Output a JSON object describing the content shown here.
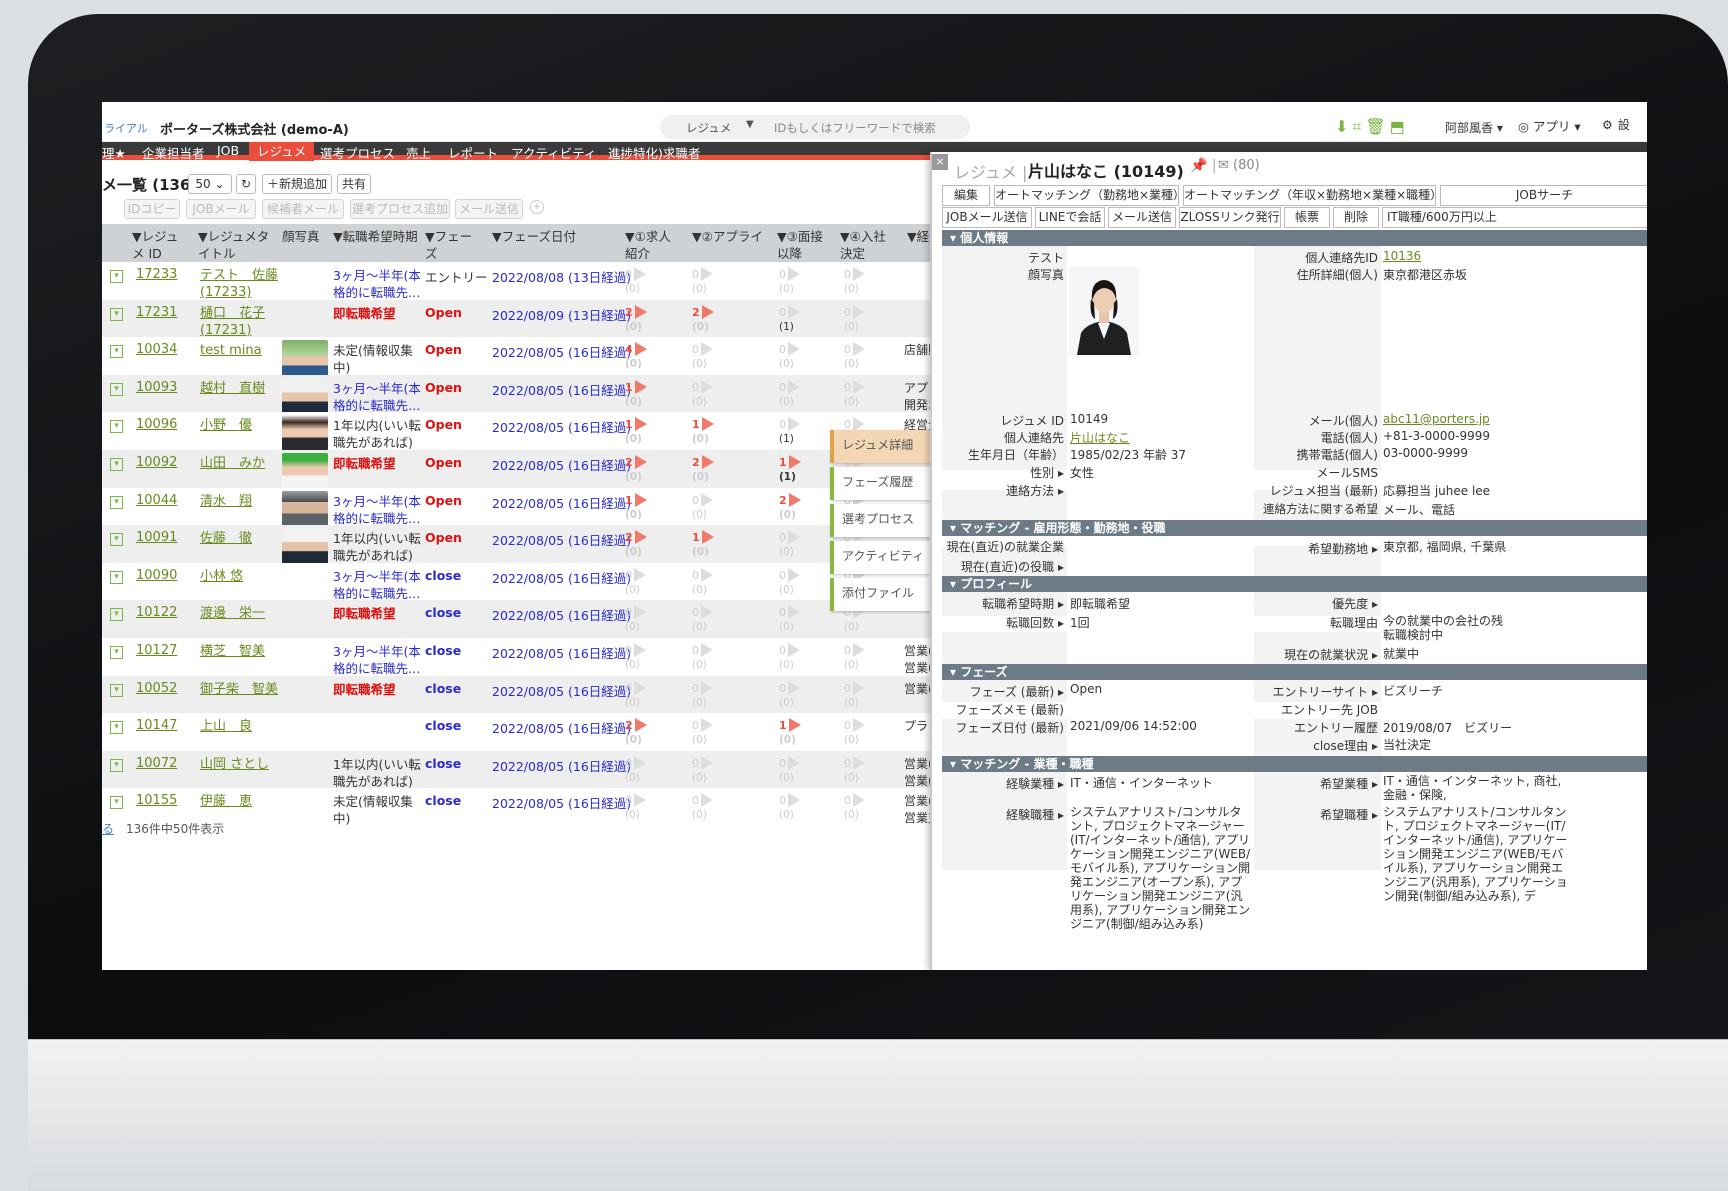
{
  "header": {
    "brand_sub": "ライアル",
    "company": "ポーターズ株式会社 (demo-A)",
    "search_select": "レジュメ",
    "search_arrow": "▼",
    "search_placeholder": "IDもしくはフリーワードで検索",
    "user": "阿部風香 ▾",
    "app": "◎ アプリ ▾",
    "settings": "設"
  },
  "nav": [
    "理★",
    "企業担当者",
    "JOB",
    "レジュメ",
    "選考プロセス",
    "売上",
    "レポート",
    "アクティビティ",
    "進捗特化)求職者"
  ],
  "list": {
    "title": "メ一覧 (136)",
    "page_size": "50 ⌄",
    "refresh": "↻",
    "add": "＋新規追加",
    "share": "共有",
    "actions": [
      "IDコピー",
      "JOBメール",
      "候補者メール",
      "選考プロセス追加",
      "メール送信"
    ],
    "columns": [
      "▼レジュ\nメ ID",
      "▼レジュメタ\nイトル",
      "顔写真",
      "▼転職希望時期",
      "▼フェー\nズ",
      "▼フェーズ日付",
      "▼①求人\n紹介",
      "▼②アプライ",
      "▼③面接\n以降",
      "▼④入社\n決定",
      "▼経"
    ],
    "rows": [
      {
        "id": "17233",
        "name": "テスト　佐藤\n(17233)",
        "timing": "3ヶ月〜半年(本\n格的に転職先…",
        "tcls": "blue",
        "phase": "エントリー",
        "pcls": "plain",
        "date": "2022/08/08 (13日経過)",
        "c1": "0",
        "c2": "0",
        "c3": "0",
        "c3sub": "(0)",
        "c4": "0",
        "ex": "",
        "photo": ""
      },
      {
        "id": "17231",
        "name": "樋口　花子\n(17231)",
        "timing": "即転職希望",
        "tcls": "red",
        "phase": "Open",
        "pcls": "red",
        "date": "2022/08/09 (13日経過)",
        "c1": "2",
        "c2": "2",
        "c3": "0",
        "c3sub": "(1)",
        "c4": "0",
        "ex": "",
        "photo": ""
      },
      {
        "id": "10034",
        "name": "test mina",
        "timing": "未定(情報収集\n中)",
        "tcls": "",
        "phase": "Open",
        "pcls": "red",
        "date": "2022/08/05 (16日経過)",
        "c1": "4",
        "c2": "0",
        "c3": "0",
        "c3sub": "(0)",
        "c4": "0",
        "ex": "店舗販",
        "photo": "m1"
      },
      {
        "id": "10093",
        "name": "越村　直樹",
        "timing": "3ヶ月〜半年(本\n格的に転職先…",
        "tcls": "blue",
        "phase": "Open",
        "pcls": "red",
        "date": "2022/08/05 (16日経過)",
        "c1": "1",
        "c2": "0",
        "c3": "0",
        "c3sub": "(0)",
        "c4": "0",
        "ex": "アプリ\n開発エ",
        "photo": "m2"
      },
      {
        "id": "10096",
        "name": "小野　優",
        "timing": "1年以内(いい転\n職先があれば)",
        "tcls": "",
        "phase": "Open",
        "pcls": "red",
        "date": "2022/08/05 (16日経過)",
        "c1": "1",
        "c2": "1",
        "c3": "0",
        "c3sub": "(1)",
        "c4": "0",
        "ex": "経営企\n画,広報",
        "photo": "f1"
      },
      {
        "id": "10092",
        "name": "山田　みか",
        "timing": "即転職希望",
        "tcls": "red",
        "phase": "Open",
        "pcls": "red",
        "date": "2022/08/05 (16日経過)",
        "c1": "2",
        "c2": "2",
        "c3": "1",
        "c3sub": "(1)",
        "c4": "0",
        "ex": "",
        "photo": "f2"
      },
      {
        "id": "10044",
        "name": "清水　翔",
        "timing": "3ヶ月〜半年(本\n格的に転職先…",
        "tcls": "blue",
        "phase": "Open",
        "pcls": "red",
        "date": "2022/08/05 (16日経過)",
        "c1": "1",
        "c2": "0",
        "c3": "2",
        "c3sub": "(0)",
        "c4": "0",
        "ex": "",
        "photo": "m3"
      },
      {
        "id": "10091",
        "name": "佐藤　徹",
        "timing": "1年以内(いい転\n職先があれば)",
        "tcls": "",
        "phase": "Open",
        "pcls": "red",
        "date": "2022/08/05 (16日経過)",
        "c1": "2",
        "c2": "1",
        "c3": "0",
        "c3sub": "(0)",
        "c4": "0",
        "ex": "",
        "photo": "m4"
      },
      {
        "id": "10090",
        "name": "小林 悠",
        "timing": "3ヶ月〜半年(本\n格的に転職先…",
        "tcls": "blue",
        "phase": "close",
        "pcls": "",
        "date": "2022/08/05 (16日経過)",
        "c1": "0",
        "c2": "0",
        "c3": "0",
        "c3sub": "(0)",
        "c4": "0",
        "ex": "",
        "photo": ""
      },
      {
        "id": "10122",
        "name": "渡邊　栄一",
        "timing": "即転職希望",
        "tcls": "red",
        "phase": "close",
        "pcls": "",
        "date": "2022/08/05 (16日経過)",
        "c1": "0",
        "c2": "0",
        "c3": "0",
        "c3sub": "(0)",
        "c4": "0",
        "ex": "",
        "photo": ""
      },
      {
        "id": "10127",
        "name": "横芝　智美",
        "timing": "3ヶ月〜半年(本\n格的に転職先…",
        "tcls": "blue",
        "phase": "close",
        "pcls": "",
        "date": "2022/08/05 (16日経過)",
        "c1": "0",
        "c2": "0",
        "c3": "0",
        "c3sub": "(0)",
        "c4": "0",
        "ex": "営業(\n営業(",
        "photo": ""
      },
      {
        "id": "10052",
        "name": "御子柴　智美",
        "timing": "即転職希望",
        "tcls": "red",
        "phase": "close",
        "pcls": "",
        "date": "2022/08/05 (16日経過)",
        "c1": "0",
        "c2": "0",
        "c3": "0",
        "c3sub": "(0)",
        "c4": "0",
        "ex": "営業(",
        "photo": ""
      },
      {
        "id": "10147",
        "name": "上山　良",
        "timing": "",
        "tcls": "",
        "phase": "close",
        "pcls": "",
        "date": "2022/08/05 (16日経過)",
        "c1": "2",
        "c2": "0",
        "c3": "1",
        "c3sub": "(0)",
        "c4": "0",
        "ex": "プラン",
        "photo": ""
      },
      {
        "id": "10072",
        "name": "山岡 さとし",
        "timing": "1年以内(いい転\n職先があれば)",
        "tcls": "",
        "phase": "close",
        "pcls": "",
        "date": "2022/08/05 (16日経過)",
        "c1": "0",
        "c2": "0",
        "c3": "0",
        "c3sub": "(0)",
        "c4": "0",
        "ex": "営業(\n営業(",
        "photo": ""
      },
      {
        "id": "10155",
        "name": "伊藤　恵",
        "timing": "未定(情報収集\n中)",
        "tcls": "",
        "phase": "close",
        "pcls": "",
        "date": "2022/08/05 (16日経過)",
        "c1": "0",
        "c2": "0",
        "c3": "0",
        "c3sub": "(0)",
        "c4": "0",
        "ex": "営業(\n営業支",
        "photo": ""
      }
    ],
    "footer_link": "る",
    "footer_text": "136件中50件表示"
  },
  "side_tabs": [
    "レジュメ詳細",
    "フェーズ履歴",
    "選考プロセス",
    "アクティビティ",
    "添付ファイル"
  ],
  "panel": {
    "close": "×",
    "title": "レジュメ |",
    "name": "片山はなこ (10149)",
    "pin": "📌 |",
    "mail": "✉ (80)",
    "buttons_row1": [
      "編集",
      "オートマッチング（勤務地×業種）",
      "オートマッチング（年収×勤務地×業種×職種）",
      "JOBサーチ"
    ],
    "buttons_row2": [
      "JOBメール送信",
      "LINEで会話",
      "メール送信",
      "ZLOSSリンク発行",
      "帳票",
      "削除",
      "IT職種/600万円以上"
    ],
    "sections": [
      "▾ 個人情報",
      "▾ マッチング - 雇用形態・勤務地・役職",
      "▾ プロフィール",
      "▾ フェーズ",
      "▾ マッチング - 業種・職種"
    ],
    "personal": {
      "test_label": "テスト",
      "photo_label": "顔写真",
      "resume_id_label": "レジュメ ID",
      "resume_id": "10149",
      "contact_label": "個人連絡先",
      "contact": "片山はなこ",
      "birth_label": "生年月日（年齢）",
      "birth": "1985/02/23 年齢 37",
      "gender_label": "性別 ▸",
      "gender": "女性",
      "method_label": "連絡方法 ▸",
      "pcid_label": "個人連絡先ID",
      "pcid": "10136",
      "addr_label": "住所詳細(個人)",
      "addr": "東京都港区赤坂",
      "email_label": "メール(個人)",
      "email": "abc11@porters.jp",
      "tel_label": "電話(個人)",
      "tel": "+81-3-0000-9999",
      "mobile_label": "携帯電話(個人)",
      "mobile": "03-0000-9999",
      "sms_label": "メールSMS",
      "owner_label": "レジュメ担当 (最新)",
      "owner": "応募担当 juhee lee",
      "pref_label": "連絡方法に関する希望",
      "pref": "メール、電話"
    },
    "matching1": {
      "company_label": "現在(直近)の就業企業",
      "role_label": "現在(直近)の役職 ▸",
      "loc_label": "希望勤務地 ▸",
      "loc": "東京都, 福岡県, 千葉県"
    },
    "profile": {
      "timing_label": "転職希望時期 ▸",
      "timing": "即転職希望",
      "count_label": "転職回数 ▸",
      "count": "1回",
      "priority_label": "優先度 ▸",
      "reason_label": "転職理由",
      "reason": "今の就業中の会社の残\n転職検討中",
      "status_label": "現在の就業状況 ▸",
      "status": "就業中"
    },
    "phase": {
      "phase_label": "フェーズ (最新) ▸",
      "phase": "Open",
      "memo_label": "フェーズメモ (最新)",
      "date_label": "フェーズ日付 (最新)",
      "date": "2021/09/06 14:52:00",
      "site_label": "エントリーサイト ▸",
      "site": "ビズリーチ",
      "job_label": "エントリー先 JOB",
      "hist_label": "エントリー履歴",
      "hist": "2019/08/07　ビズリー",
      "close_label": "close理由 ▸",
      "close": "当社決定"
    },
    "matching2": {
      "exp_ind_label": "経験業種 ▸",
      "exp_ind": "IT・通信・インターネット",
      "exp_job_label": "経験職種 ▸",
      "exp_job": "システムアナリスト/コンサルタント, プロジェクトマネージャー(IT/インターネット/通信), アプリケーション開発エンジニア(WEB/モバイル系), アプリケーション開発エンジニア(オープン系), アプリケーション開発エンジニア(汎用系), アプリケーション開発エンジニア(制御/組み込み系)",
      "want_ind_label": "希望業種 ▸",
      "want_ind": "IT・通信・インターネット, 商社, 金融・保険,",
      "want_job_label": "希望職種 ▸",
      "want_job": "システムアナリスト/コンサルタント, プロジェクトマネージャー(IT/インターネット/通信), アプリケーション開発エンジニア(WEB/モバイル系), アプリケーション開発エンジニア(汎用系), アプリケーション開発(制御/組み込み系), デ"
    }
  },
  "colors": {
    "accent": "#e94e3d",
    "nav": "#3a3a3a",
    "link": "#6a8a1e",
    "section": "#6d7b87",
    "blue": "#2a2ad0"
  }
}
